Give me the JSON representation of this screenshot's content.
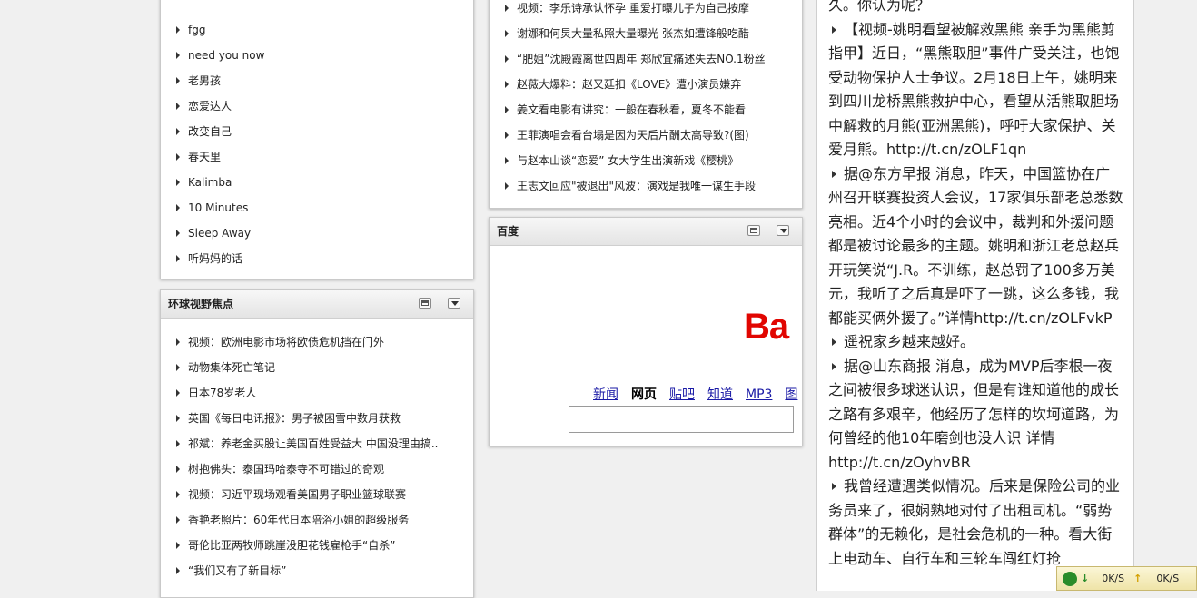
{
  "left_top_list": [
    "fgg",
    "need you now",
    "老男孩",
    "恋爱达人",
    "改变自己",
    "春天里",
    "Kalimba",
    "10 Minutes",
    "Sleep Away",
    "听妈妈的话"
  ],
  "global_panel": {
    "title": "环球视野焦点",
    "items": [
      "视频：欧洲电影市场将欧债危机挡在门外",
      "动物集体死亡笔记",
      "日本78岁老人",
      "英国《每日电讯报》：男子被困雪中数月获救",
      "祁斌：养老金买股让美国百姓受益大 中国没理由搞..",
      "树抱佛头：泰国玛哈泰寺不可错过的奇观",
      "视频：习近平现场观看美国男子职业篮球联赛",
      "香艳老照片：60年代日本陪浴小姐的超级服务",
      "哥伦比亚两牧师跳崖没胆花钱雇枪手“自杀”",
      "“我们又有了新目标”"
    ]
  },
  "news_panel": {
    "items": [
      "视频：李乐诗承认怀孕 重爱打曝儿子为自己按摩",
      "谢娜和何炅大量私照大量曝光 张杰如遭锋般吃醋",
      "“肥姐”沈殿霞离世四周年 郑欣宜痛述失去NO.1粉丝",
      "赵薇大爆料：赵又廷扣《LOVE》遭小演员嫌弃",
      "姜文看电影有讲究：一般在春秋看，夏冬不能看",
      "王菲演唱会看台塌是因为天后片酬太高导致?(图)",
      "与赵本山谈“恋爱” 女大学生出演新戏《樱桃》",
      "王志文回应\"被退出\"风波：演戏是我唯一谋生手段"
    ]
  },
  "baidu_panel": {
    "title": "百度",
    "logo_text": "Ba",
    "links": [
      "新闻",
      "网页",
      "贴吧",
      "知道",
      "MP3",
      "图"
    ],
    "active_link": "网页"
  },
  "weibo": {
    "top_fragment": "久。你认为呢？",
    "posts": [
      "【视频-姚明看望被解救黑熊 亲手为黑熊剪指甲】近日，“黑熊取胆”事件广受关注，也饱受动物保护人士争议。2月18日上午，姚明来到四川龙桥黑熊救护中心，看望从活熊取胆场中解救的月熊(亚洲黑熊)，呼吁大家保护、关爱月熊。http://t.cn/zOLF1qn",
      "据@东方早报 消息，昨天，中国篮协在广州召开联赛投资人会议，17家俱乐部老总悉数亮相。近4个小时的会议中，裁判和外援问题都是被讨论最多的主题。姚明和浙江老总赵兵开玩笑说“J.R。不训练，赵总罚了100多万美元，我听了之后真是吓了一跳，这么多钱，我都能买俩外援了。”详情http://t.cn/zOLFvkP",
      "遥祝家乡越来越好。",
      "据@山东商报 消息，成为MVP后李根一夜之间被很多球迷认识，但是有谁知道他的成长之路有多艰辛，他经历了怎样的坎坷道路，为何曾经的他10年磨剑也没人识 详情http://t.cn/zOyhvBR",
      "我曾经遭遇类似情况。后来是保险公司的业务员来了，很娴熟地对付了出租司机。“弱势群体”的无赖化，是社会危机的一种。看大街上电动车、自行车和三轮车闯红灯抢"
    ]
  },
  "tray": {
    "down": "0K/S",
    "up": "0K/S"
  },
  "colors": {
    "logo_red": "#e10601",
    "link_blue": "#1a1aa6",
    "tray_icon": "#2a8c2a"
  }
}
